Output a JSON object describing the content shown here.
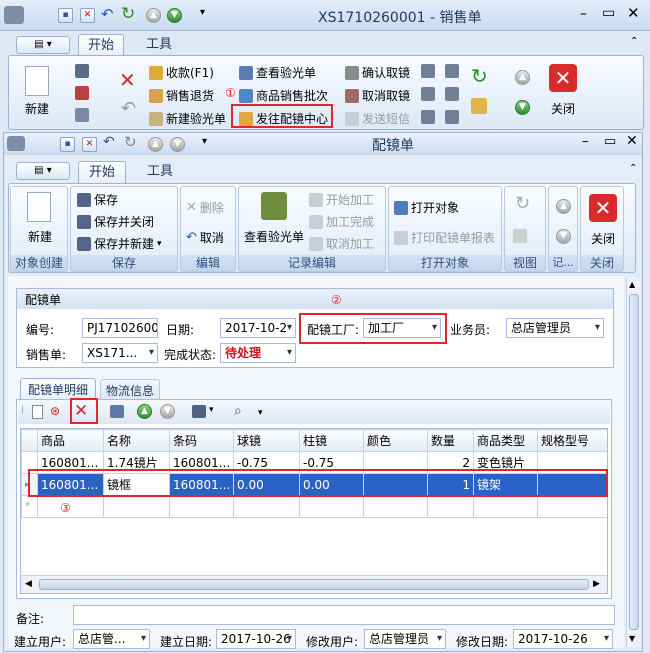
{
  "outer": {
    "title": "XS1710260001 - 销售单",
    "tabs": [
      "开始",
      "工具"
    ],
    "big_new": "新建",
    "menu": [
      "收款(F1)",
      "销售退货",
      "新建验光单",
      "查看验光单",
      "商品销售批次",
      "发往配镜中心",
      "确认取镜",
      "取消取镜",
      "发送短信"
    ],
    "close": "关闭"
  },
  "inner": {
    "title": "配镜单",
    "tabs": [
      "开始",
      "工具"
    ],
    "groups": {
      "create": {
        "label": "对象创建",
        "new": "新建"
      },
      "save": {
        "label": "保存",
        "items": [
          "保存",
          "保存并关闭",
          "保存并新建"
        ]
      },
      "edit": {
        "label": "编辑",
        "items": [
          "删除",
          "取消"
        ]
      },
      "record": {
        "label": "记录编辑",
        "big": "查看验光单",
        "items": [
          "开始加工",
          "加工完成",
          "取消加工"
        ]
      },
      "open": {
        "label": "打开对象",
        "items": [
          "打开对象",
          "打印配镜单报表"
        ]
      },
      "view": {
        "label": "视图"
      },
      "rec": {
        "label": "记..."
      },
      "close": {
        "label": "关闭",
        "big": "关闭"
      }
    }
  },
  "form": {
    "section": "配镜单",
    "no_label": "编号:",
    "no_value": "PJ17102600",
    "date_label": "日期:",
    "date_value": "2017-10-2",
    "factory_label": "配镜工厂:",
    "factory_value": "加工厂",
    "clerk_label": "业务员:",
    "clerk_value": "总店管理员",
    "sale_label": "销售单:",
    "sale_value": "XS171...",
    "status_label": "完成状态:",
    "status_value": "待处理"
  },
  "detail": {
    "tabs": [
      "配镜单明细",
      "物流信息"
    ],
    "columns": [
      "商品",
      "名称",
      "条码",
      "球镜",
      "柱镜",
      "颜色",
      "数量",
      "商品类型",
      "规格型号"
    ],
    "rows": [
      {
        "product": "160801...",
        "name": "1.74镜片",
        "barcode": "160801...",
        "sph": "-0.75",
        "cyl": "-0.75",
        "color": "",
        "qty": "2",
        "type": "变色镜片",
        "spec": ""
      },
      {
        "product": "160801...",
        "name": "镜框",
        "barcode": "160801...",
        "sph": "0.00",
        "cyl": "0.00",
        "color": "",
        "qty": "1",
        "type": "镜架",
        "spec": ""
      }
    ]
  },
  "footer": {
    "remark_label": "备注:",
    "remark_value": "",
    "creator_label": "建立用户:",
    "creator_value": "总店管...",
    "cdate_label": "建立日期:",
    "cdate_value": "2017-10-26",
    "modifier_label": "修改用户:",
    "modifier_value": "总店管理员",
    "mdate_label": "修改日期:",
    "mdate_value": "2017-10-26"
  },
  "annotations": {
    "n1": "①",
    "n2": "②",
    "n3": "③"
  },
  "colors": {
    "highlight": "#e0262f",
    "selection": "#2a63c5",
    "status_red": "#d0101a"
  }
}
